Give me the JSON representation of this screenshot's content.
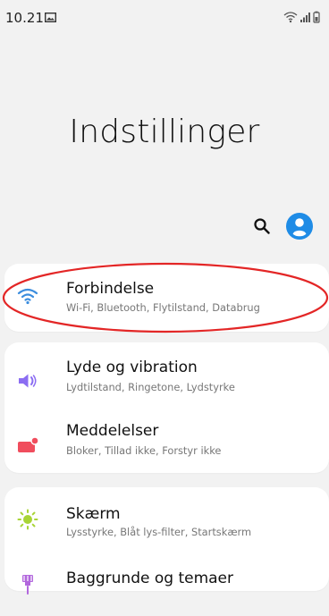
{
  "status": {
    "time": "10.21",
    "icons": [
      "image-icon",
      "wifi-signal-icon",
      "cellular-signal-icon",
      "battery-icon"
    ]
  },
  "title": "Indstillinger",
  "top_actions": {
    "search_icon": "search-icon",
    "profile_icon": "profile-avatar-icon",
    "profile_color": "#1f8ce6"
  },
  "settings": {
    "connections": {
      "title": "Forbindelse",
      "subtitle": "Wi-Fi, Bluetooth, Flytilstand, Databrug",
      "icon": "wifi-icon",
      "color": "#3b8dde"
    },
    "sounds": {
      "title": "Lyde og vibration",
      "subtitle": "Lydtilstand, Ringetone, Lydstyrke",
      "icon": "volume-icon",
      "color": "#8b6df2"
    },
    "notifications": {
      "title": "Meddelelser",
      "subtitle": "Bloker, Tillad ikke, Forstyr ikke",
      "icon": "notification-icon",
      "color": "#f04d5d"
    },
    "display": {
      "title": "Skærm",
      "subtitle": "Lysstyrke, Blåt lys-filter, Startskærm",
      "icon": "sun-icon",
      "color": "#a8d436"
    },
    "wallpaper": {
      "title": "Baggrunde og temaer",
      "subtitle": "",
      "icon": "paintbrush-icon",
      "color": "#b267dd"
    }
  },
  "annotation": {
    "color": "#e32626"
  }
}
